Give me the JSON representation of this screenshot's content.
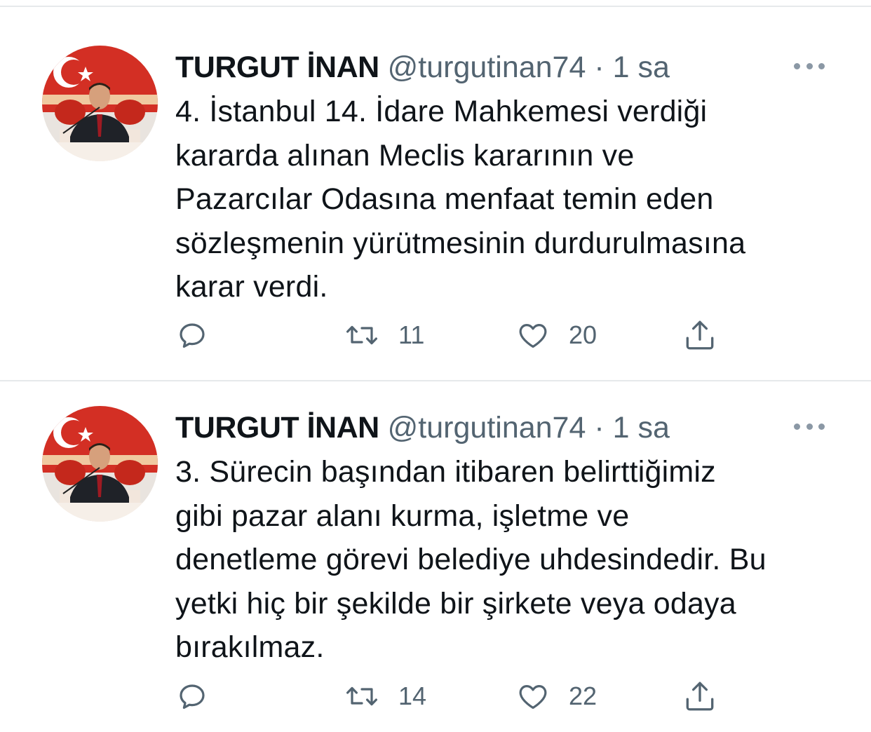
{
  "tweets": [
    {
      "author": {
        "name": "TURGUT İNAN",
        "handle": "@turgutinan74",
        "avatar_icon": "profile-photo"
      },
      "separator": "·",
      "time": "1 sa",
      "text": "4. İstanbul 14. İdare Mahkemesi verdiği\nkararda alınan Meclis kararının ve\nPazarcılar Odasına menfaat temin eden\nsözleşmenin yürütmesinin durdurulmasına\nkarar verdi.",
      "stats": {
        "retweets": "11",
        "likes": "20"
      }
    },
    {
      "author": {
        "name": "TURGUT İNAN",
        "handle": "@turgutinan74",
        "avatar_icon": "profile-photo"
      },
      "separator": "·",
      "time": "1 sa",
      "text": "3. Sürecin başından itibaren belirttiğimiz\ngibi pazar alanı kurma, işletme ve\ndenetleme görevi belediye uhdesindedir. Bu\nyetki hiç bir şekilde bir şirkete veya odaya\nbırakılmaz.",
      "stats": {
        "retweets": "14",
        "likes": "22"
      }
    }
  ],
  "icons": {
    "reply": "reply-icon",
    "retweet": "retweet-icon",
    "like": "heart-icon",
    "share": "share-icon",
    "more": "more-icon"
  },
  "colors": {
    "text": "#0f1419",
    "secondary": "#536471",
    "divider": "#e6e9eb"
  }
}
